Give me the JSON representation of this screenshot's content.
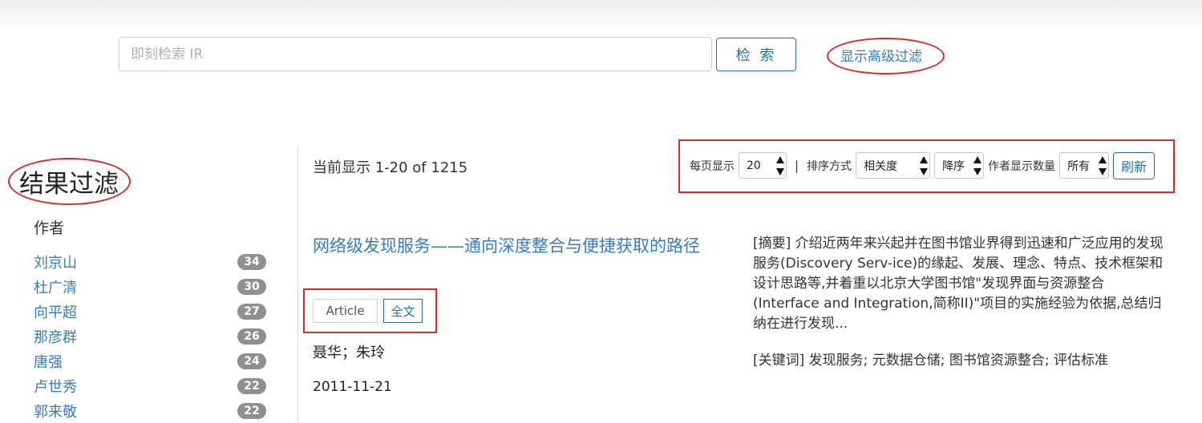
{
  "search": {
    "placeholder": "即刻检索 IR",
    "button_label": "检 索",
    "advanced_filter_link": "显示高级过滤"
  },
  "sidebar": {
    "title": "结果过滤",
    "facet_title": "作者",
    "authors": [
      {
        "name": "刘京山",
        "count": "34"
      },
      {
        "name": "杜广清",
        "count": "30"
      },
      {
        "name": "向平超",
        "count": "27"
      },
      {
        "name": "那彦群",
        "count": "26"
      },
      {
        "name": "唐强",
        "count": "24"
      },
      {
        "name": "卢世秀",
        "count": "22"
      },
      {
        "name": "郭来敬",
        "count": "22"
      }
    ]
  },
  "results_header": {
    "showing": "当前显示 1-20 of 1215",
    "per_page_label": "每页显示",
    "per_page_value": "20",
    "separator": "|",
    "sort_label": "排序方式",
    "sort_value": "相关度",
    "order_value": "降序",
    "author_count_label": "作者显示数量",
    "author_count_value": "所有",
    "refresh_label": "刷新"
  },
  "result": {
    "title": "网络级发现服务——通向深度整合与便捷获取的路径",
    "type_tag": "Article",
    "fulltext_tag": "全文",
    "authors": "聂华；朱玲",
    "date": "2011-11-21",
    "abstract": "[摘要] 介绍近两年来兴起并在图书馆业界得到迅速和广泛应用的发现服务(Discovery Serv-ice)的缘起、发展、理念、特点、技术框架和设计思路等,并着重以北京大学图书馆\"发现界面与资源整合(Interface and Integration,简称II)\"项目的实施经验为依据,总结归纳在进行发现...",
    "keywords": "[关键词] 发现服务; 元数据仓储; 图书馆资源整合; 评估标准"
  },
  "colors": {
    "link": "#3a7bbd",
    "primary_border": "#2e6da4",
    "badge": "#8f8f8f",
    "annotation_red": "#e02828"
  }
}
